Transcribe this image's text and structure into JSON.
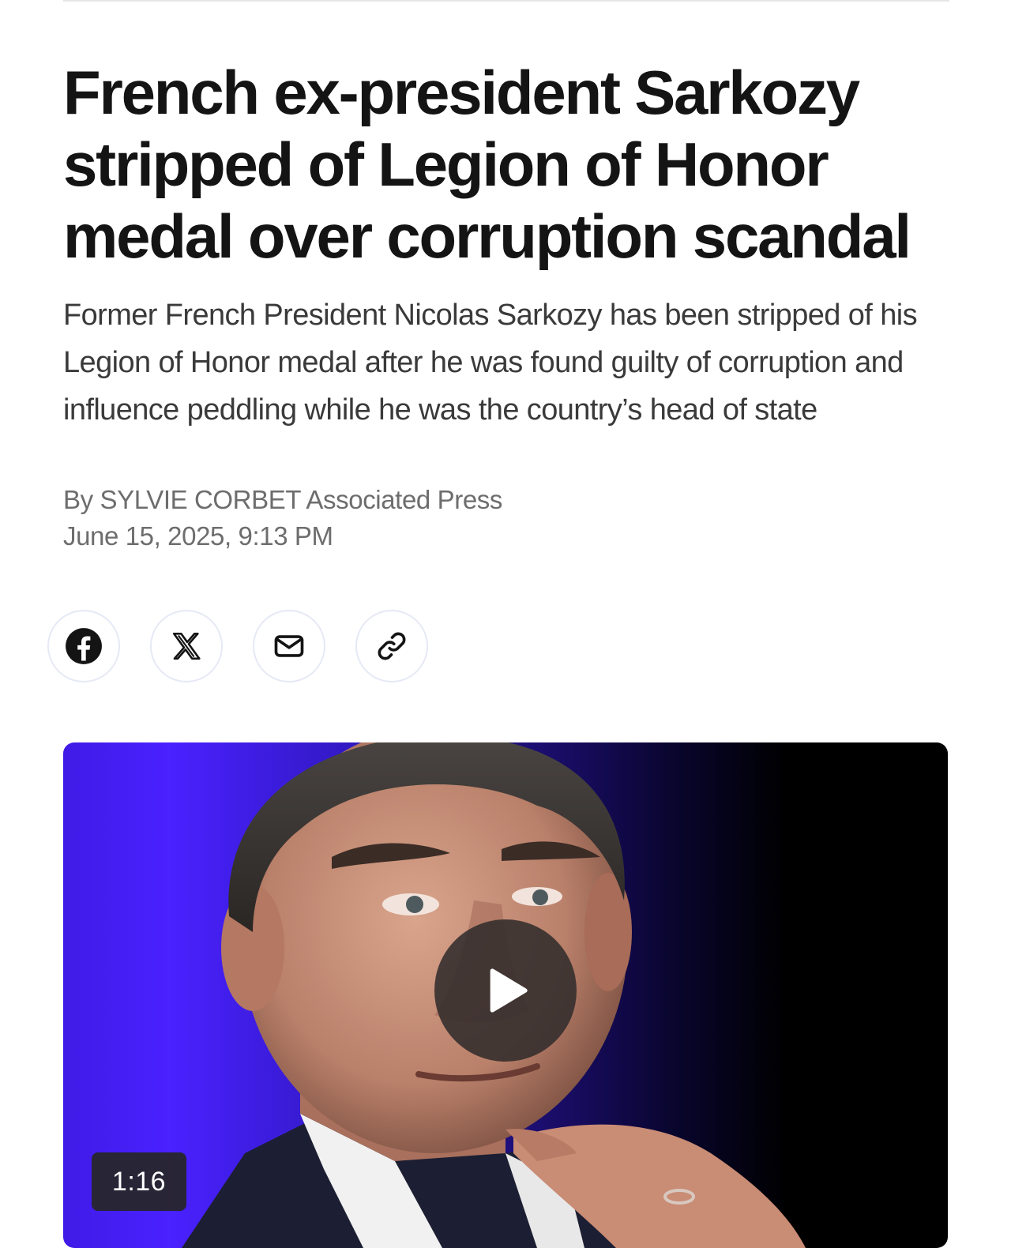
{
  "article": {
    "headline": "French ex-president Sarkozy stripped of Legion of Honor medal over corruption scandal",
    "dek": "Former French President Nicolas Sarkozy has been stripped of his Legion of Honor medal after he was found guilty of corruption and influence peddling while he was the country’s head of state",
    "byline": "By SYLVIE CORBET Associated Press",
    "dateline": "June 15, 2025, 9:13 PM"
  },
  "share": {
    "buttons": [
      {
        "icon": "facebook-icon"
      },
      {
        "icon": "x-icon"
      },
      {
        "icon": "mail-icon"
      },
      {
        "icon": "link-icon"
      }
    ]
  },
  "video": {
    "duration": "1:16",
    "play_icon": "play-icon"
  },
  "colors": {
    "text": "#141414",
    "dek": "#3a3a3a",
    "meta": "#6d6d6d",
    "share_border": "#e6e9f5",
    "video_backdrop": "#4a21ff"
  }
}
